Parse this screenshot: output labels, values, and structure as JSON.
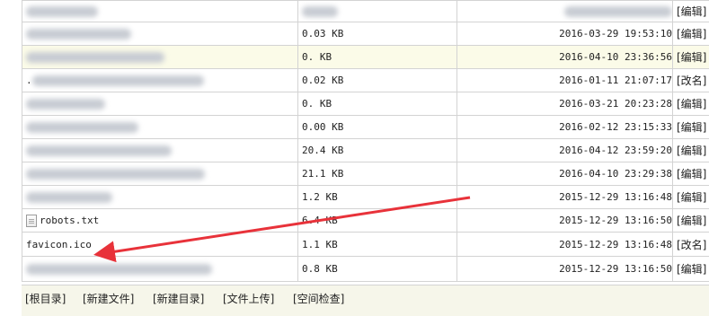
{
  "rows": [
    {
      "name": "",
      "size": "",
      "time": "",
      "action": "[编辑]",
      "name_blur": true,
      "size_blur": true,
      "time_blur": true
    },
    {
      "name": "",
      "size": "0.03 KB",
      "time": "2016-03-29 19:53:10",
      "action": "[编辑]",
      "name_blur": true
    },
    {
      "name": "",
      "size": "0. KB",
      "time": "2016-04-10 23:36:56",
      "action": "[编辑]",
      "name_blur": true
    },
    {
      "name": ".",
      "size": "0.02 KB",
      "time": "2016-01-11 21:07:17",
      "action": "[改名]",
      "name_blur": true
    },
    {
      "name": "",
      "size": "0. KB",
      "time": "2016-03-21 20:23:28",
      "action": "[编辑]",
      "name_blur": true
    },
    {
      "name": "",
      "size": "0.00 KB",
      "time": "2016-02-12 23:15:33",
      "action": "[编辑]",
      "name_blur": true
    },
    {
      "name": "",
      "size": "20.4 KB",
      "time": "2016-04-12 23:59:20",
      "action": "[编辑]",
      "name_blur": true
    },
    {
      "name": "",
      "size": "21.1 KB",
      "time": "2016-04-10 23:29:38",
      "action": "[编辑]",
      "name_blur": true
    },
    {
      "name": "",
      "size": "1.2 KB",
      "time": "2015-12-29 13:16:48",
      "action": "[编辑]",
      "name_blur": true
    },
    {
      "name": "robots.txt",
      "size": "6.4 KB",
      "time": "2015-12-29 13:16:50",
      "action": "[编辑]",
      "icon": "text-file-icon"
    },
    {
      "name": "favicon.ico",
      "size": "1.1 KB",
      "time": "2015-12-29 13:16:48",
      "action": "[改名]"
    },
    {
      "name": "",
      "size": "0.8 KB",
      "time": "2015-12-29 13:16:50",
      "action": "[编辑]",
      "name_blur": true
    }
  ],
  "footer": {
    "root": "[根目录]",
    "new_file": "[新建文件]",
    "new_dir": "[新建目录]",
    "upload": "[文件上传]",
    "space_check": "[空间检查]"
  },
  "colors": {
    "arrow": "#e8323a",
    "highlight_row": "#fbfbe8",
    "border": "#d3d3d3"
  }
}
